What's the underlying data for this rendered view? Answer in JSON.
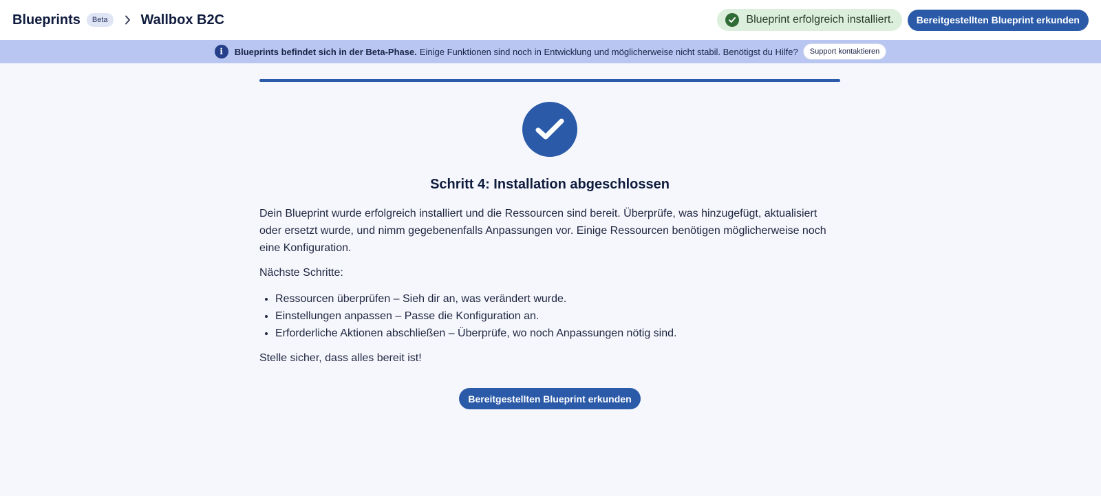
{
  "header": {
    "breadcrumb_root": "Blueprints",
    "beta_badge": "Beta",
    "breadcrumb_current": "Wallbox B2C",
    "toast_text": "Blueprint erfolgreich installiert.",
    "explore_button_label": "Bereitgestellten Blueprint erkunden"
  },
  "banner": {
    "strong_text": "Blueprints befindet sich in der Beta-Phase.",
    "body_text": "Einige Funktionen sind noch in Entwicklung und möglicherweise nicht stabil. Benötigst du Hilfe?",
    "support_button_label": "Support kontaktieren"
  },
  "progress": {
    "fraction": 1.0
  },
  "content": {
    "title": "Schritt 4: Installation abgeschlossen",
    "intro": "Dein Blueprint wurde erfolgreich installiert und die Ressourcen sind bereit. Überprüfe, was hinzugefügt, aktualisiert oder ersetzt wurde, und nimm gegebenenfalls Anpassungen vor. Einige Ressourcen benötigen möglicherweise noch eine Konfiguration.",
    "next_steps_label": "Nächste Schritte:",
    "next_steps": [
      "Ressourcen überprüfen – Sieh dir an, was verändert wurde.",
      "Einstellungen anpassen – Passe die Konfiguration an.",
      "Erforderliche Aktionen abschließen – Überprüfe, wo noch Anpassungen nötig sind."
    ],
    "outro": "Stelle sicher, dass alles bereit ist!",
    "cta_label": "Bereitgestellten Blueprint erkunden"
  },
  "colors": {
    "primary": "#2a5aa8",
    "banner_bg": "#b8c6f1",
    "toast_bg": "#dcefdc",
    "toast_icon": "#2e6b35",
    "page_bg": "#f5f7fc"
  },
  "icons": {
    "breadcrumb_separator": "chevron-right-icon",
    "toast": "check-circle-icon",
    "banner": "info-icon",
    "success": "checkmark-icon"
  }
}
